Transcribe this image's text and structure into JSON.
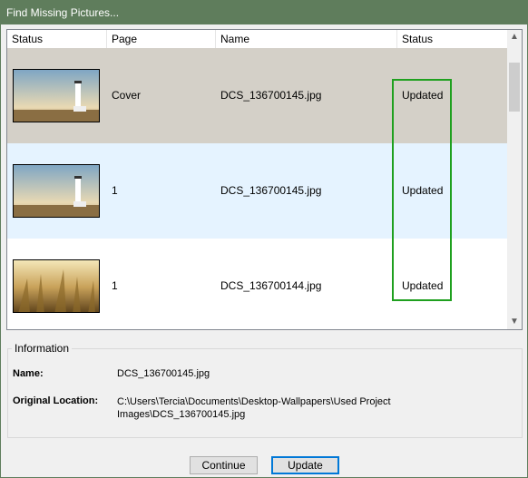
{
  "window": {
    "title": "Find Missing Pictures..."
  },
  "list": {
    "columns": [
      "Status",
      "Page",
      "Name",
      "Status"
    ],
    "rows": [
      {
        "thumbnail": "lighthouse-icon",
        "page": "Cover",
        "name": "DCS_136700145.jpg",
        "status": "Updated",
        "selected": true
      },
      {
        "thumbnail": "lighthouse-icon",
        "page": "1",
        "name": "DCS_136700145.jpg",
        "status": "Updated"
      },
      {
        "thumbnail": "wheat-field-icon",
        "page": "1",
        "name": "DCS_136700144.jpg",
        "status": "Updated"
      }
    ]
  },
  "info": {
    "legend": "Information",
    "name_label": "Name:",
    "name_value": "DCS_136700145.jpg",
    "location_label": "Original Location:",
    "location_line1": "C:\\Users\\Tercia\\Documents\\Desktop-Wallpapers\\Used Project",
    "location_line2": "Images\\DCS_136700145.jpg"
  },
  "buttons": {
    "continue": "Continue",
    "update": "Update"
  },
  "colors": {
    "titlebar": "#5f7d5c",
    "selected_row": "#d4d0c8",
    "hover_row": "#e5f3ff",
    "highlight": "#1fa01f"
  }
}
